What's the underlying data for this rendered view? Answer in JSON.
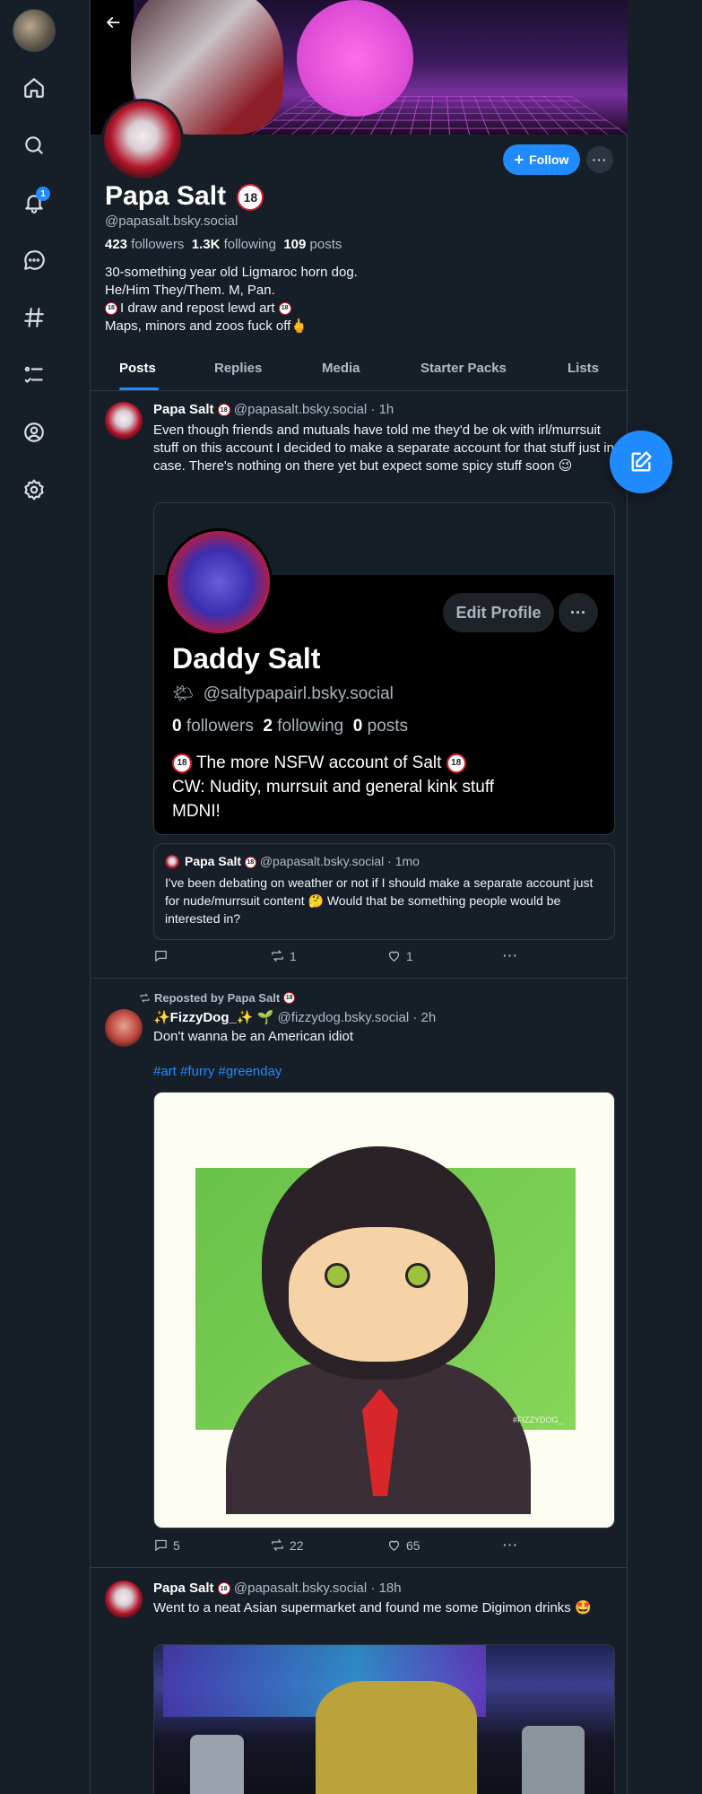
{
  "nav": {
    "items": [
      {
        "name": "home-icon"
      },
      {
        "name": "search-icon"
      },
      {
        "name": "bell-icon",
        "badge": "1"
      },
      {
        "name": "chat-icon"
      },
      {
        "name": "hashtag-icon"
      },
      {
        "name": "list-icon"
      },
      {
        "name": "profile-icon"
      },
      {
        "name": "gear-icon"
      }
    ]
  },
  "profile": {
    "name": "Papa Salt",
    "badge": "18",
    "handle": "@papasalt.bsky.social",
    "followers": "423",
    "followers_label": "followers",
    "following": "1.3K",
    "following_label": "following",
    "posts": "109",
    "posts_label": "posts",
    "bio_lines": [
      "30-something year old Ligmaroc horn dog.",
      "He/Him They/Them. M, Pan.",
      "I draw and repost lewd art",
      "Maps, minors and zoos fuck off🖕"
    ],
    "follow_label": "Follow"
  },
  "tabs": [
    "Posts",
    "Replies",
    "Media",
    "Starter Packs",
    "Lists"
  ],
  "posts": [
    {
      "author": "Papa Salt",
      "handle": "@papasalt.bsky.social",
      "time": "· 1h",
      "text": "Even though friends and mutuals have told me they'd be ok with irl/murrsuit stuff on this account I decided to make a separate account for that stuff just in case. There's nothing on there yet but expect some spicy stuff soon 😉",
      "embed": {
        "edit_label": "Edit Profile",
        "name": "Daddy Salt",
        "handle_emoji": "🌤",
        "handle": "@saltypapairl.bsky.social",
        "followers": "0",
        "followers_label": "followers",
        "following": "2",
        "following_label": "following",
        "posts": "0",
        "posts_label": "posts",
        "bio_line1": "The more NSFW account of Salt",
        "bio_line2": "CW: Nudity, murrsuit and general kink stuff",
        "bio_line3": "MDNI!"
      },
      "quote": {
        "author": "Papa Salt",
        "handle": "@papasalt.bsky.social",
        "time": "· 1mo",
        "text": "I've been debating on weather or not if I should make a separate account just for nude/murrsuit content 🤔 Would that be something people would be interested in?"
      },
      "replies": "",
      "reposts": "1",
      "likes": "1"
    },
    {
      "reposted_by": "Reposted by Papa Salt",
      "author": "✨FizzyDog_✨ 🌱",
      "handle": "@fizzydog.bsky.social",
      "time": "· 2h",
      "text": "Don't wanna be an American idiot",
      "hashtags": "#art #furry #greenday",
      "art_signature": "#FIZZYDOG_",
      "replies": "5",
      "reposts": "22",
      "likes": "65"
    },
    {
      "author": "Papa Salt",
      "handle": "@papasalt.bsky.social",
      "time": "· 18h",
      "text": "Went to a neat Asian supermarket and found me some Digimon drinks 🤩"
    }
  ],
  "colors": {
    "accent": "#208bfe",
    "background": "#161e27",
    "border": "#2e3a47",
    "muted": "#aebbc9"
  }
}
